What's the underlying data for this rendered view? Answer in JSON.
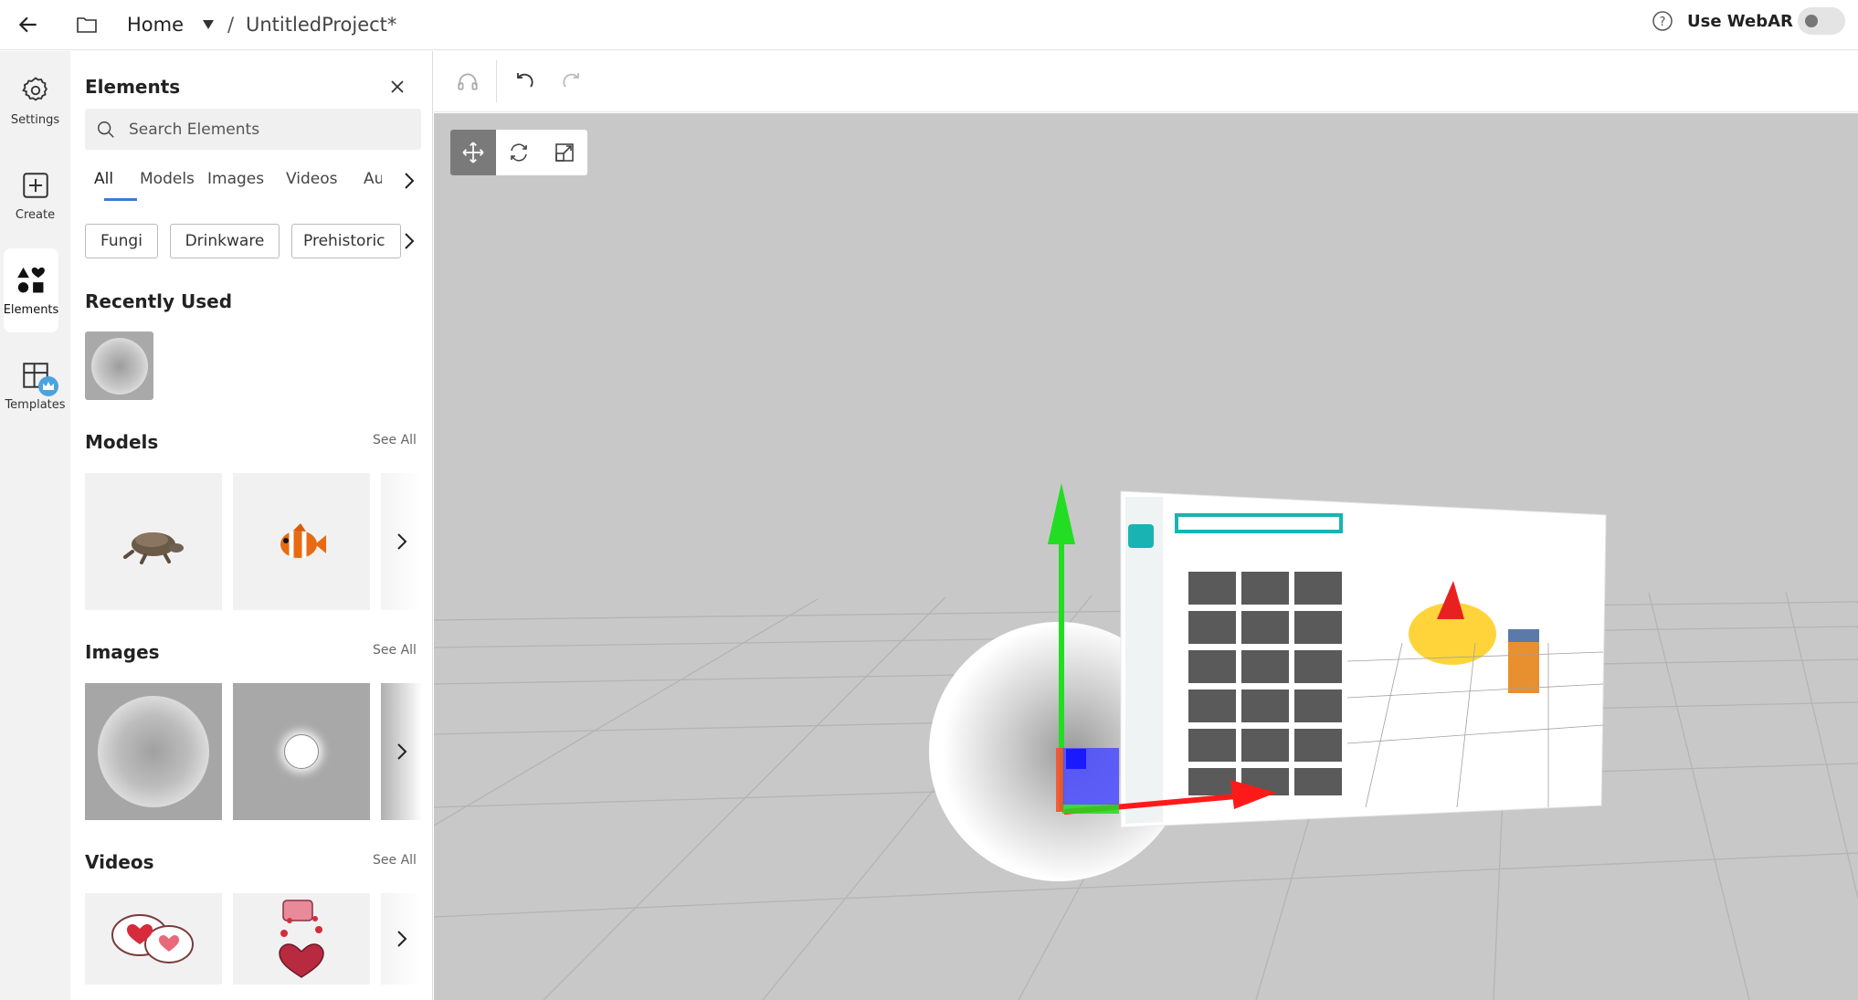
{
  "topbar": {
    "breadcrumb_home": "Home",
    "breadcrumb_sep": "/",
    "project_name": "UntitledProject*",
    "webar_label": "Use WebAR",
    "webar_enabled": false
  },
  "rail": [
    {
      "label": "Settings",
      "icon": "gear-icon"
    },
    {
      "label": "Create",
      "icon": "plus-square-icon"
    },
    {
      "label": "Elements",
      "icon": "shapes-icon",
      "active": true
    },
    {
      "label": "Templates",
      "icon": "templates-icon"
    }
  ],
  "panel": {
    "title": "Elements",
    "search_placeholder": "Search Elements",
    "tabs": [
      "All",
      "Models",
      "Images",
      "Videos",
      "Au"
    ],
    "chips": [
      "Fungi",
      "Drinkware",
      "Prehistoric"
    ],
    "recent_title": "Recently Used",
    "models_title": "Models",
    "images_title": "Images",
    "videos_title": "Videos",
    "see_all": "See All"
  },
  "colors": {
    "accent": "#3a7bd5",
    "viewport_bg": "#c8c8c8",
    "axis_x": "#ff1a1a",
    "axis_y": "#22dd22",
    "axis_z": "#2222ff"
  }
}
